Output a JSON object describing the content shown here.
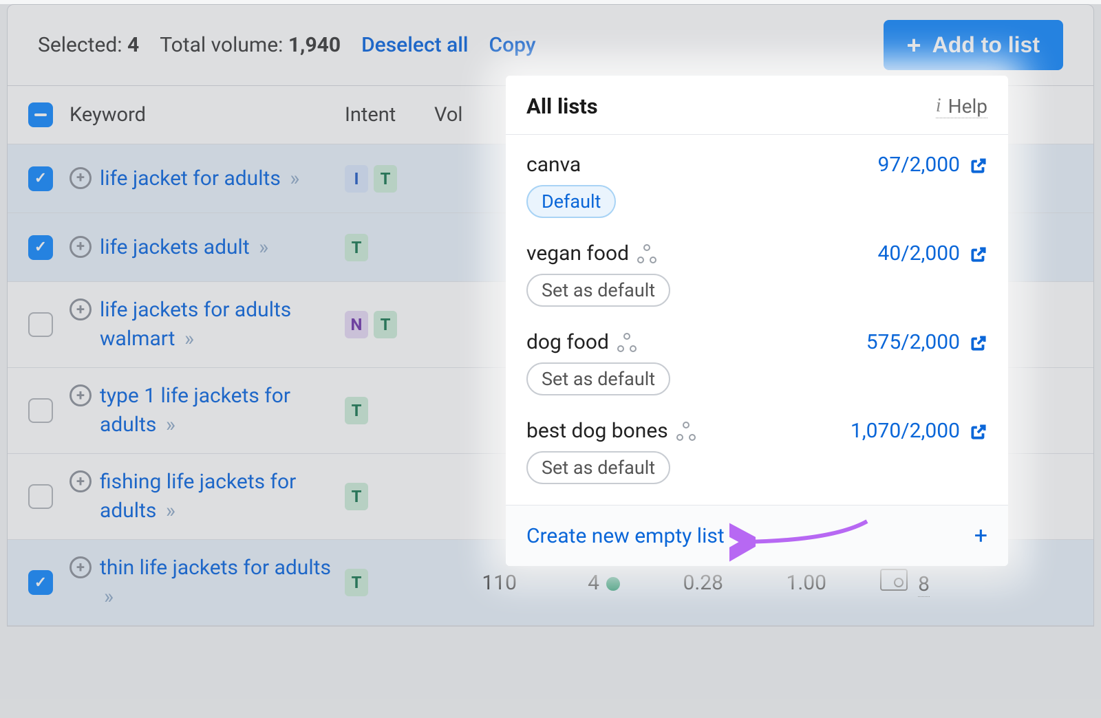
{
  "topbar": {
    "selected_label": "Selected:",
    "selected_count": "4",
    "total_volume_label": "Total volume:",
    "total_volume": "1,940",
    "deselect_label": "Deselect all",
    "copy_label": "Copy",
    "add_to_list_label": "Add to list"
  },
  "columns": {
    "keyword": "Keyword",
    "intent": "Intent",
    "volume": "Vol"
  },
  "rows": [
    {
      "checked": true,
      "keyword": "life jacket for adults",
      "intents": [
        "I",
        "T"
      ]
    },
    {
      "checked": true,
      "keyword": "life jackets adult",
      "intents": [
        "T"
      ]
    },
    {
      "checked": false,
      "keyword": "life jackets for adults walmart",
      "intents": [
        "N",
        "T"
      ]
    },
    {
      "checked": false,
      "keyword": "type 1 life jackets for adults",
      "intents": [
        "T"
      ]
    },
    {
      "checked": false,
      "keyword": "fishing life jackets for adults",
      "intents": [
        "T"
      ]
    },
    {
      "checked": true,
      "keyword": "thin life jackets for adults",
      "intents": [
        "T"
      ],
      "volume": "110",
      "kd": "4",
      "cpc": "0.28",
      "comp": "1.00",
      "urls": "8"
    }
  ],
  "dropdown": {
    "title": "All lists",
    "help_label": "Help",
    "default_badge": "Default",
    "set_default_label": "Set as default",
    "create_label": "Create new empty list",
    "lists": [
      {
        "name": "canva",
        "count": "97/2,000",
        "is_default": true,
        "has_cluster": false
      },
      {
        "name": "vegan food",
        "count": "40/2,000",
        "is_default": false,
        "has_cluster": true
      },
      {
        "name": "dog food",
        "count": "575/2,000",
        "is_default": false,
        "has_cluster": true
      },
      {
        "name": "best dog bones",
        "count": "1,070/2,000",
        "is_default": false,
        "has_cluster": true
      }
    ]
  }
}
